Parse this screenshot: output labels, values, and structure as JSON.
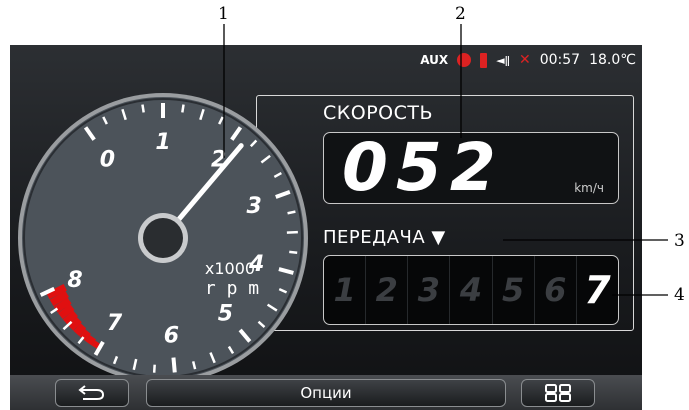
{
  "callouts": [
    "1",
    "2",
    "3",
    "4"
  ],
  "status": {
    "aux_label": "AUX",
    "time": "00:57",
    "temperature": "18.0℃"
  },
  "speed": {
    "label": "СКОРОСТЬ",
    "value": "052",
    "unit": "km/ч"
  },
  "gear": {
    "label": "ПЕРЕДАЧА ▼",
    "options": [
      "1",
      "2",
      "3",
      "4",
      "5",
      "6",
      "7"
    ],
    "current": "7"
  },
  "tachometer": {
    "tick_labels": [
      "0",
      "1",
      "2",
      "3",
      "4",
      "5",
      "6",
      "7",
      "8"
    ],
    "multiplier": "x1000",
    "unit": "r p m",
    "redline_start": 7,
    "max": 8,
    "needle_value": 2.15
  },
  "bottom": {
    "back_icon": "back-arrow-icon",
    "options_label": "Опции",
    "grid_icon": "grid-icon"
  },
  "colors": {
    "redline": "#e01010",
    "status_red": "#dd2222"
  }
}
